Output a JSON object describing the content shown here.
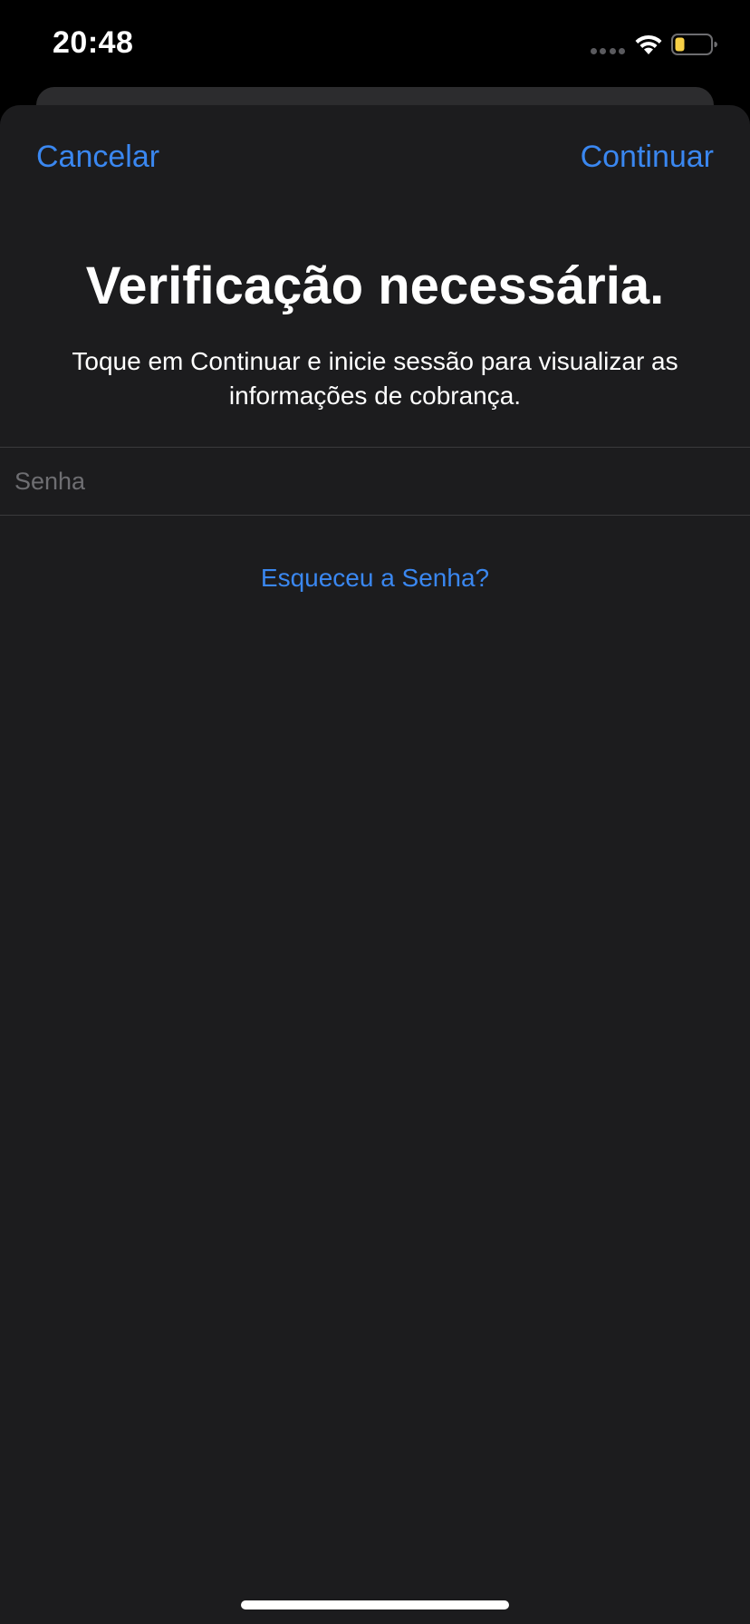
{
  "status_bar": {
    "time": "20:48",
    "wifi_icon": "wifi-icon",
    "battery_icon": "battery-low-icon",
    "battery_color": "#f7d046"
  },
  "nav": {
    "cancel_label": "Cancelar",
    "continue_label": "Continuar"
  },
  "main": {
    "title": "Verificação necessária.",
    "subtitle": "Toque em Continuar e inicie sessão para visualizar as informações de cobrança.",
    "password_placeholder": "Senha",
    "password_value": "",
    "forgot_label": "Esqueceu a Senha?"
  },
  "colors": {
    "accent": "#3a87f0",
    "sheet_background": "#1c1c1e",
    "background": "#000000"
  }
}
